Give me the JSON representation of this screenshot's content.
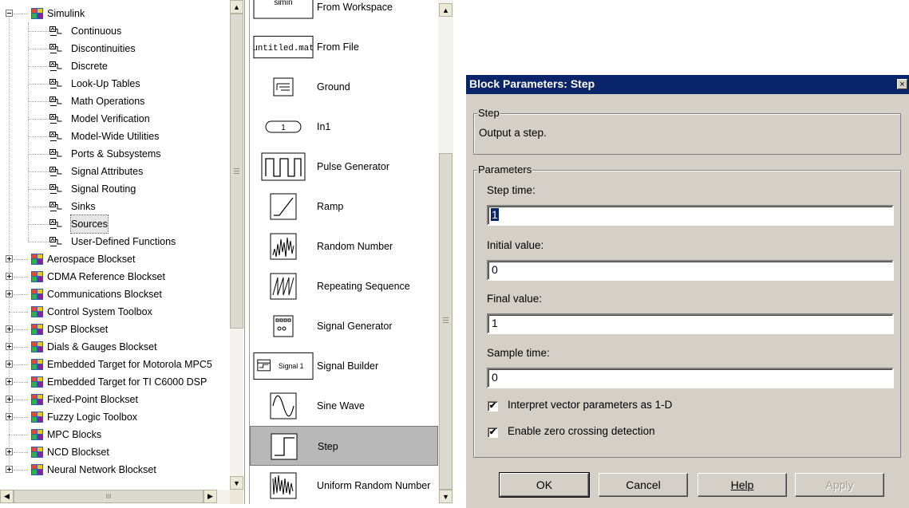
{
  "tree": {
    "items": [
      {
        "label": "Simulink",
        "kind": "library",
        "expander": "minus",
        "indent": 0
      },
      {
        "label": "Continuous",
        "kind": "sublib",
        "indent": 1
      },
      {
        "label": "Discontinuities",
        "kind": "sublib",
        "indent": 1
      },
      {
        "label": "Discrete",
        "kind": "sublib",
        "indent": 1
      },
      {
        "label": "Look-Up Tables",
        "kind": "sublib",
        "indent": 1
      },
      {
        "label": "Math Operations",
        "kind": "sublib",
        "indent": 1
      },
      {
        "label": "Model Verification",
        "kind": "sublib",
        "indent": 1
      },
      {
        "label": "Model-Wide Utilities",
        "kind": "sublib",
        "indent": 1
      },
      {
        "label": "Ports & Subsystems",
        "kind": "sublib",
        "indent": 1
      },
      {
        "label": "Signal Attributes",
        "kind": "sublib",
        "indent": 1
      },
      {
        "label": "Signal Routing",
        "kind": "sublib",
        "indent": 1
      },
      {
        "label": "Sinks",
        "kind": "sublib",
        "indent": 1
      },
      {
        "label": "Sources",
        "kind": "sublib",
        "indent": 1,
        "selected": true
      },
      {
        "label": "User-Defined Functions",
        "kind": "sublib",
        "indent": 1
      },
      {
        "label": "Aerospace Blockset",
        "kind": "library",
        "expander": "plus",
        "indent": 0
      },
      {
        "label": "CDMA Reference Blockset",
        "kind": "library",
        "expander": "plus",
        "indent": 0
      },
      {
        "label": "Communications Blockset",
        "kind": "library",
        "expander": "plus",
        "indent": 0
      },
      {
        "label": "Control System Toolbox",
        "kind": "library",
        "expander": "none",
        "indent": 0
      },
      {
        "label": "DSP Blockset",
        "kind": "library",
        "expander": "plus",
        "indent": 0
      },
      {
        "label": "Dials & Gauges Blockset",
        "kind": "library",
        "expander": "plus",
        "indent": 0
      },
      {
        "label": "Embedded Target for Motorola MPC5",
        "kind": "library",
        "expander": "plus",
        "indent": 0
      },
      {
        "label": "Embedded Target for TI C6000 DSP",
        "kind": "library",
        "expander": "plus",
        "indent": 0
      },
      {
        "label": "Fixed-Point Blockset",
        "kind": "library",
        "expander": "plus",
        "indent": 0
      },
      {
        "label": "Fuzzy Logic Toolbox",
        "kind": "library",
        "expander": "plus",
        "indent": 0
      },
      {
        "label": "MPC Blocks",
        "kind": "library",
        "expander": "none",
        "indent": 0
      },
      {
        "label": "NCD Blockset",
        "kind": "library",
        "expander": "plus",
        "indent": 0
      },
      {
        "label": "Neural Network Blockset",
        "kind": "library",
        "expander": "plus",
        "indent": 0
      }
    ],
    "hscroll_grip": "III"
  },
  "blocks": {
    "items": [
      {
        "label": "From Workspace",
        "icon": "from-workspace",
        "icon_text": "simin"
      },
      {
        "label": "From File",
        "icon": "from-file",
        "icon_text": "untitled.mat"
      },
      {
        "label": "Ground",
        "icon": "ground"
      },
      {
        "label": "In1",
        "icon": "inport",
        "icon_text": "1"
      },
      {
        "label": "Pulse Generator",
        "icon": "pulse"
      },
      {
        "label": "Ramp",
        "icon": "ramp"
      },
      {
        "label": "Random Number",
        "icon": "random"
      },
      {
        "label": "Repeating Sequence",
        "icon": "repeating"
      },
      {
        "label": "Signal Generator",
        "icon": "siggen"
      },
      {
        "label": "Signal Builder",
        "icon": "sigbuilder",
        "icon_text": "Signal 1"
      },
      {
        "label": "Sine Wave",
        "icon": "sine"
      },
      {
        "label": "Step",
        "icon": "step",
        "selected": true
      },
      {
        "label": "Uniform Random Number",
        "icon": "uniform"
      }
    ]
  },
  "dialog": {
    "title": "Block Parameters: Step",
    "close_glyph": "×",
    "description_group": "Step",
    "description": "Output a step.",
    "params_group": "Parameters",
    "fields": [
      {
        "label": "Step time:",
        "value": "1",
        "selected": true
      },
      {
        "label": "Initial value:",
        "value": "0"
      },
      {
        "label": "Final value:",
        "value": "1"
      },
      {
        "label": "Sample time:",
        "value": "0"
      }
    ],
    "checkboxes": [
      {
        "label": "Interpret vector parameters as 1-D",
        "checked": true
      },
      {
        "label": "Enable zero crossing detection",
        "checked": true
      }
    ],
    "check_glyph": "✔",
    "buttons": {
      "ok": "OK",
      "cancel": "Cancel",
      "help": "Help",
      "apply": "Apply"
    },
    "colors": {
      "titlebar": "#0a246a",
      "face": "#d4d0c8"
    }
  }
}
